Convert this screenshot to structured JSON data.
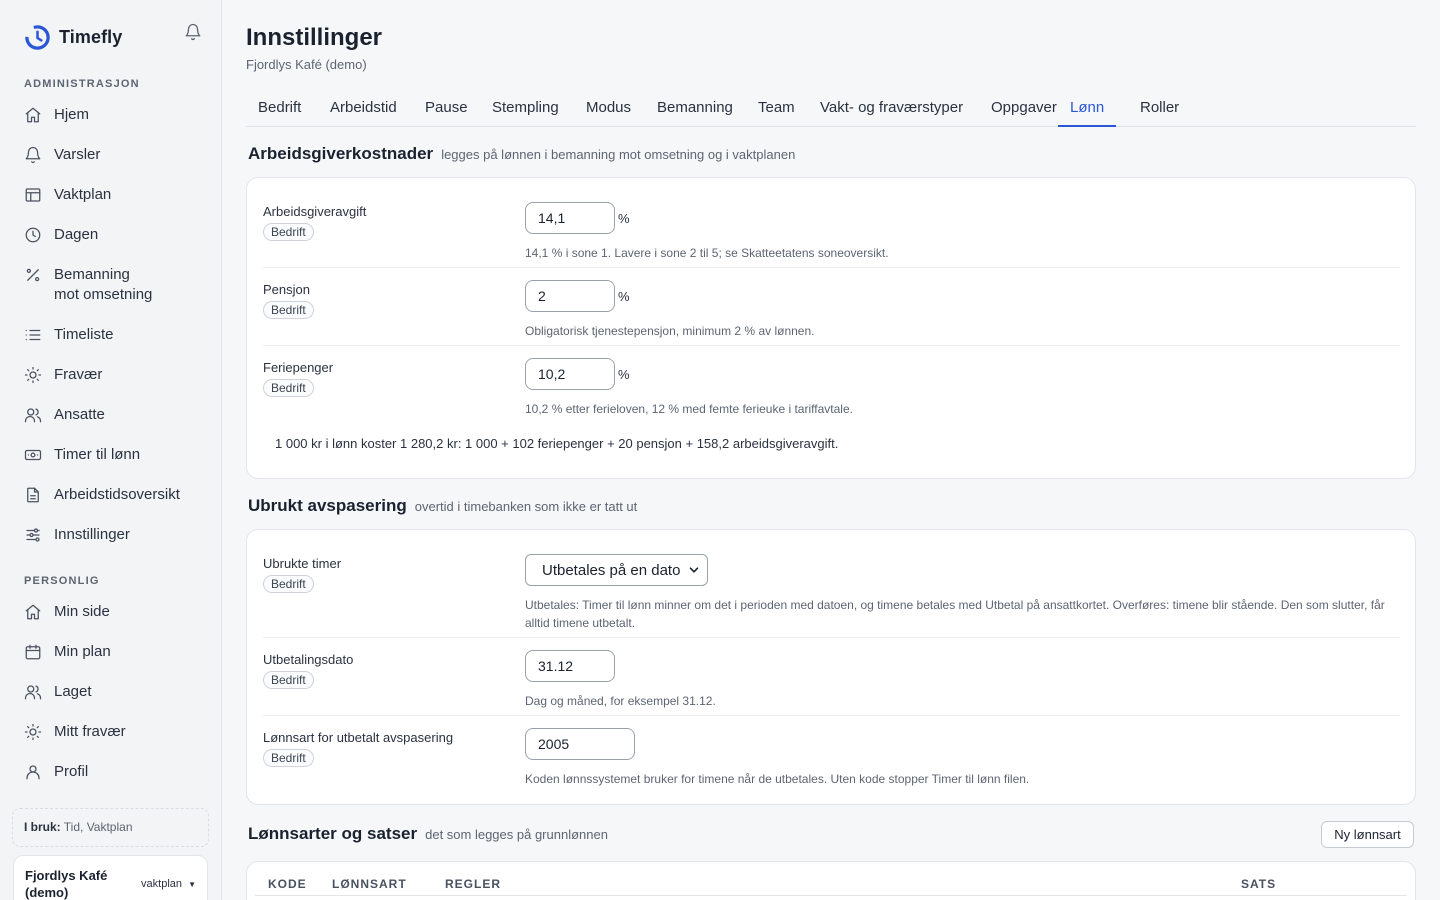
{
  "app": {
    "name": "Timefly"
  },
  "sidebar": {
    "admin_label": "ADMINISTRASJON",
    "admin_items": [
      {
        "label": "Hjem",
        "icon": "home-icon"
      },
      {
        "label": "Varsler",
        "icon": "bell-icon"
      },
      {
        "label": "Vaktplan",
        "icon": "table-icon"
      },
      {
        "label": "Dagen",
        "icon": "clock-icon"
      },
      {
        "label": "Bemanning\nmot omsetning",
        "icon": "percent-icon"
      },
      {
        "label": "Timeliste",
        "icon": "list-icon"
      },
      {
        "label": "Fravær",
        "icon": "sun-icon"
      },
      {
        "label": "Ansatte",
        "icon": "users-icon"
      },
      {
        "label": "Timer til lønn",
        "icon": "banknote-icon"
      },
      {
        "label": "Arbeidstidsoversikt",
        "icon": "document-icon"
      },
      {
        "label": "Innstillinger",
        "icon": "sliders-icon"
      }
    ],
    "personal_label": "PERSONLIG",
    "personal_items": [
      {
        "label": "Min side",
        "icon": "home-icon"
      },
      {
        "label": "Min plan",
        "icon": "calendar-icon"
      },
      {
        "label": "Laget",
        "icon": "users-icon"
      },
      {
        "label": "Mitt fravær",
        "icon": "sun-icon"
      },
      {
        "label": "Profil",
        "icon": "user-icon"
      }
    ],
    "in_use_label": "I bruk:",
    "in_use_value": "Tid, Vaktplan",
    "company": {
      "name": "Fjordlys Kafé (demo)",
      "plan": "vaktplan"
    }
  },
  "header": {
    "title": "Innstillinger",
    "subtitle": "Fjordlys Kafé (demo)"
  },
  "tabs": [
    "Bedrift",
    "Arbeidstid",
    "Pause",
    "Stempling",
    "Modus",
    "Bemanning",
    "Team",
    "Vakt- og fraværstyper",
    "Oppgaver",
    "Lønn",
    "Roller"
  ],
  "active_tab": "Lønn",
  "colors": {
    "accent": "#2b56d6",
    "brand": "#2b56d6"
  },
  "employer_costs": {
    "title": "Arbeidsgiverkostnader",
    "desc": "legges på lønnen i bemanning mot omsetning og i vaktplanen",
    "rows": [
      {
        "label": "Arbeidsgiveravgift",
        "badge": "Bedrift",
        "value": "14,1",
        "unit": "%",
        "hint": "14,1 % i sone 1. Lavere i sone 2 til 5; se Skatteetatens soneoversikt."
      },
      {
        "label": "Pensjon",
        "badge": "Bedrift",
        "value": "2",
        "unit": "%",
        "hint": "Obligatorisk tjenestepensjon, minimum 2 % av lønnen."
      },
      {
        "label": "Feriepenger",
        "badge": "Bedrift",
        "value": "10,2",
        "unit": "%",
        "hint": "10,2 % etter ferieloven, 12 % med femte ferieuke i tariffavtale."
      }
    ],
    "summary": "1 000 kr i lønn koster 1 280,2 kr: 1 000 + 102 feriepenger + 20 pensjon + 158,2 arbeidsgiveravgift."
  },
  "unused_leave": {
    "title": "Ubrukt avspasering",
    "desc": "overtid i timebanken som ikke er tatt ut",
    "rows": [
      {
        "label": "Ubrukte timer",
        "badge": "Bedrift",
        "value": "Utbetales på en dato",
        "hint": "Utbetales: Timer til lønn minner om det i perioden med datoen, og timene betales med Utbetal på ansattkortet. Overføres: timene blir stående. Den som slutter, får alltid timene utbetalt."
      },
      {
        "label": "Utbetalingsdato",
        "badge": "Bedrift",
        "value": "31.12",
        "hint": "Dag og måned, for eksempel 31.12."
      },
      {
        "label": "Lønnsart for utbetalt avspasering",
        "badge": "Bedrift",
        "value": "2005",
        "hint": "Koden lønnssystemet bruker for timene når de utbetales. Uten kode stopper Timer til lønn filen."
      }
    ]
  },
  "wage_types": {
    "title": "Lønnsarter og satser",
    "desc": "det som legges på grunnlønnen",
    "new_button": "Ny lønnsart",
    "columns": [
      "KODE",
      "LØNNSART",
      "REGLER",
      "SATS"
    ]
  }
}
